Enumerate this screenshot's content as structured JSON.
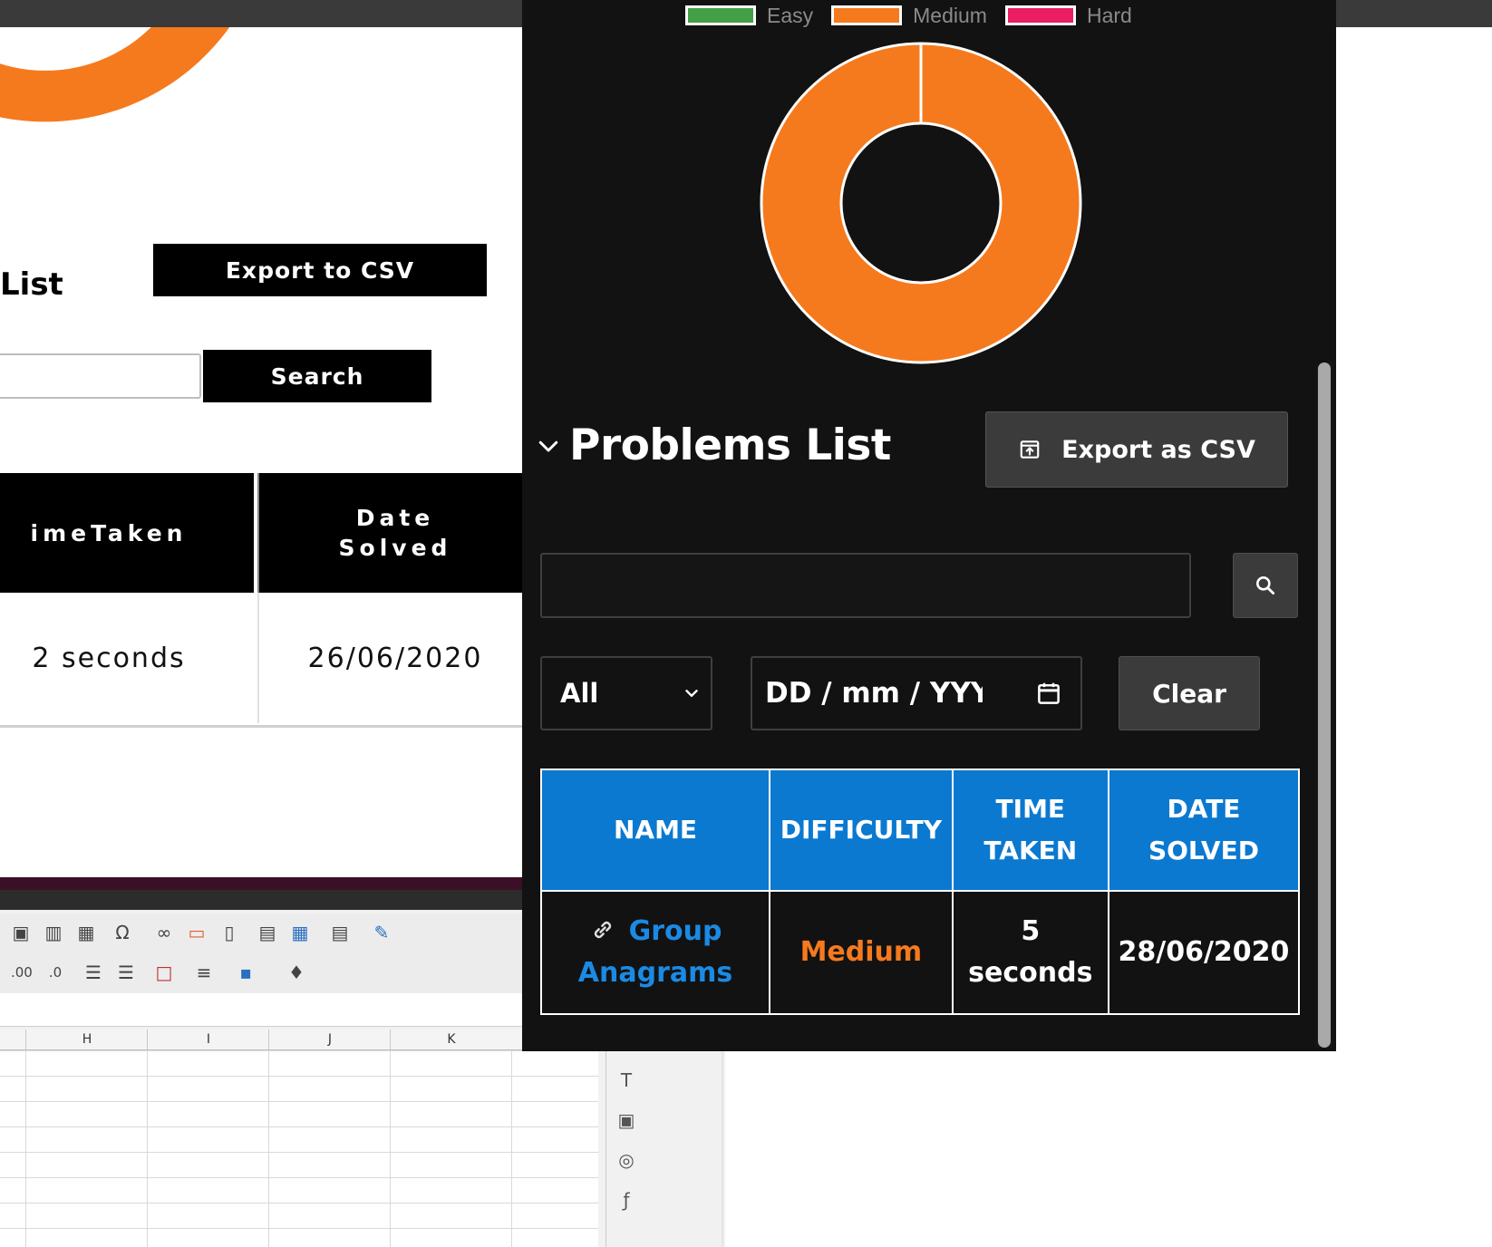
{
  "background_page": {
    "title_fragment": "List",
    "export_button": "Export to CSV",
    "search_button": "Search",
    "table_headers": {
      "time": "imeTaken",
      "date": "Date\nSolved"
    },
    "row": {
      "time": "2 seconds",
      "date": "26/06/2020"
    }
  },
  "spreadsheet": {
    "columns": [
      "H",
      "I",
      "J",
      "K"
    ]
  },
  "chart": {
    "legend": [
      {
        "label": "Easy",
        "color": "#43a047"
      },
      {
        "label": "Medium",
        "color": "#f57a1e"
      },
      {
        "label": "Hard",
        "color": "#e91e63"
      }
    ]
  },
  "chart_data": {
    "type": "pie",
    "categories": [
      "Easy",
      "Medium",
      "Hard"
    ],
    "values": [
      0,
      1,
      0
    ],
    "colors": [
      "#43a047",
      "#f57a1e",
      "#e91e63"
    ],
    "legend": "top",
    "donut": true
  },
  "popup": {
    "section_title": "Problems List",
    "export_label": "Export as CSV",
    "search": {
      "value": "",
      "placeholder": "",
      "icon": "search-icon"
    },
    "difficulty_filter": {
      "selected": "All"
    },
    "date_filter": {
      "placeholder": "DD / mm / YYYY",
      "icon": "calendar-icon"
    },
    "clear_label": "Clear",
    "table": {
      "headers": [
        "NAME",
        "DIFFICULTY",
        "TIME TAKEN",
        "DATE SOLVED"
      ],
      "rows": [
        {
          "name": "Group Anagrams",
          "difficulty": "Medium",
          "time_taken": "5 seconds",
          "date_solved": "28/06/2020"
        }
      ]
    }
  },
  "colors": {
    "accent_blue": "#0b79d0",
    "medium_orange": "#f57a1e",
    "popup_bg": "#121212",
    "button_bg": "#3b3b3b"
  }
}
